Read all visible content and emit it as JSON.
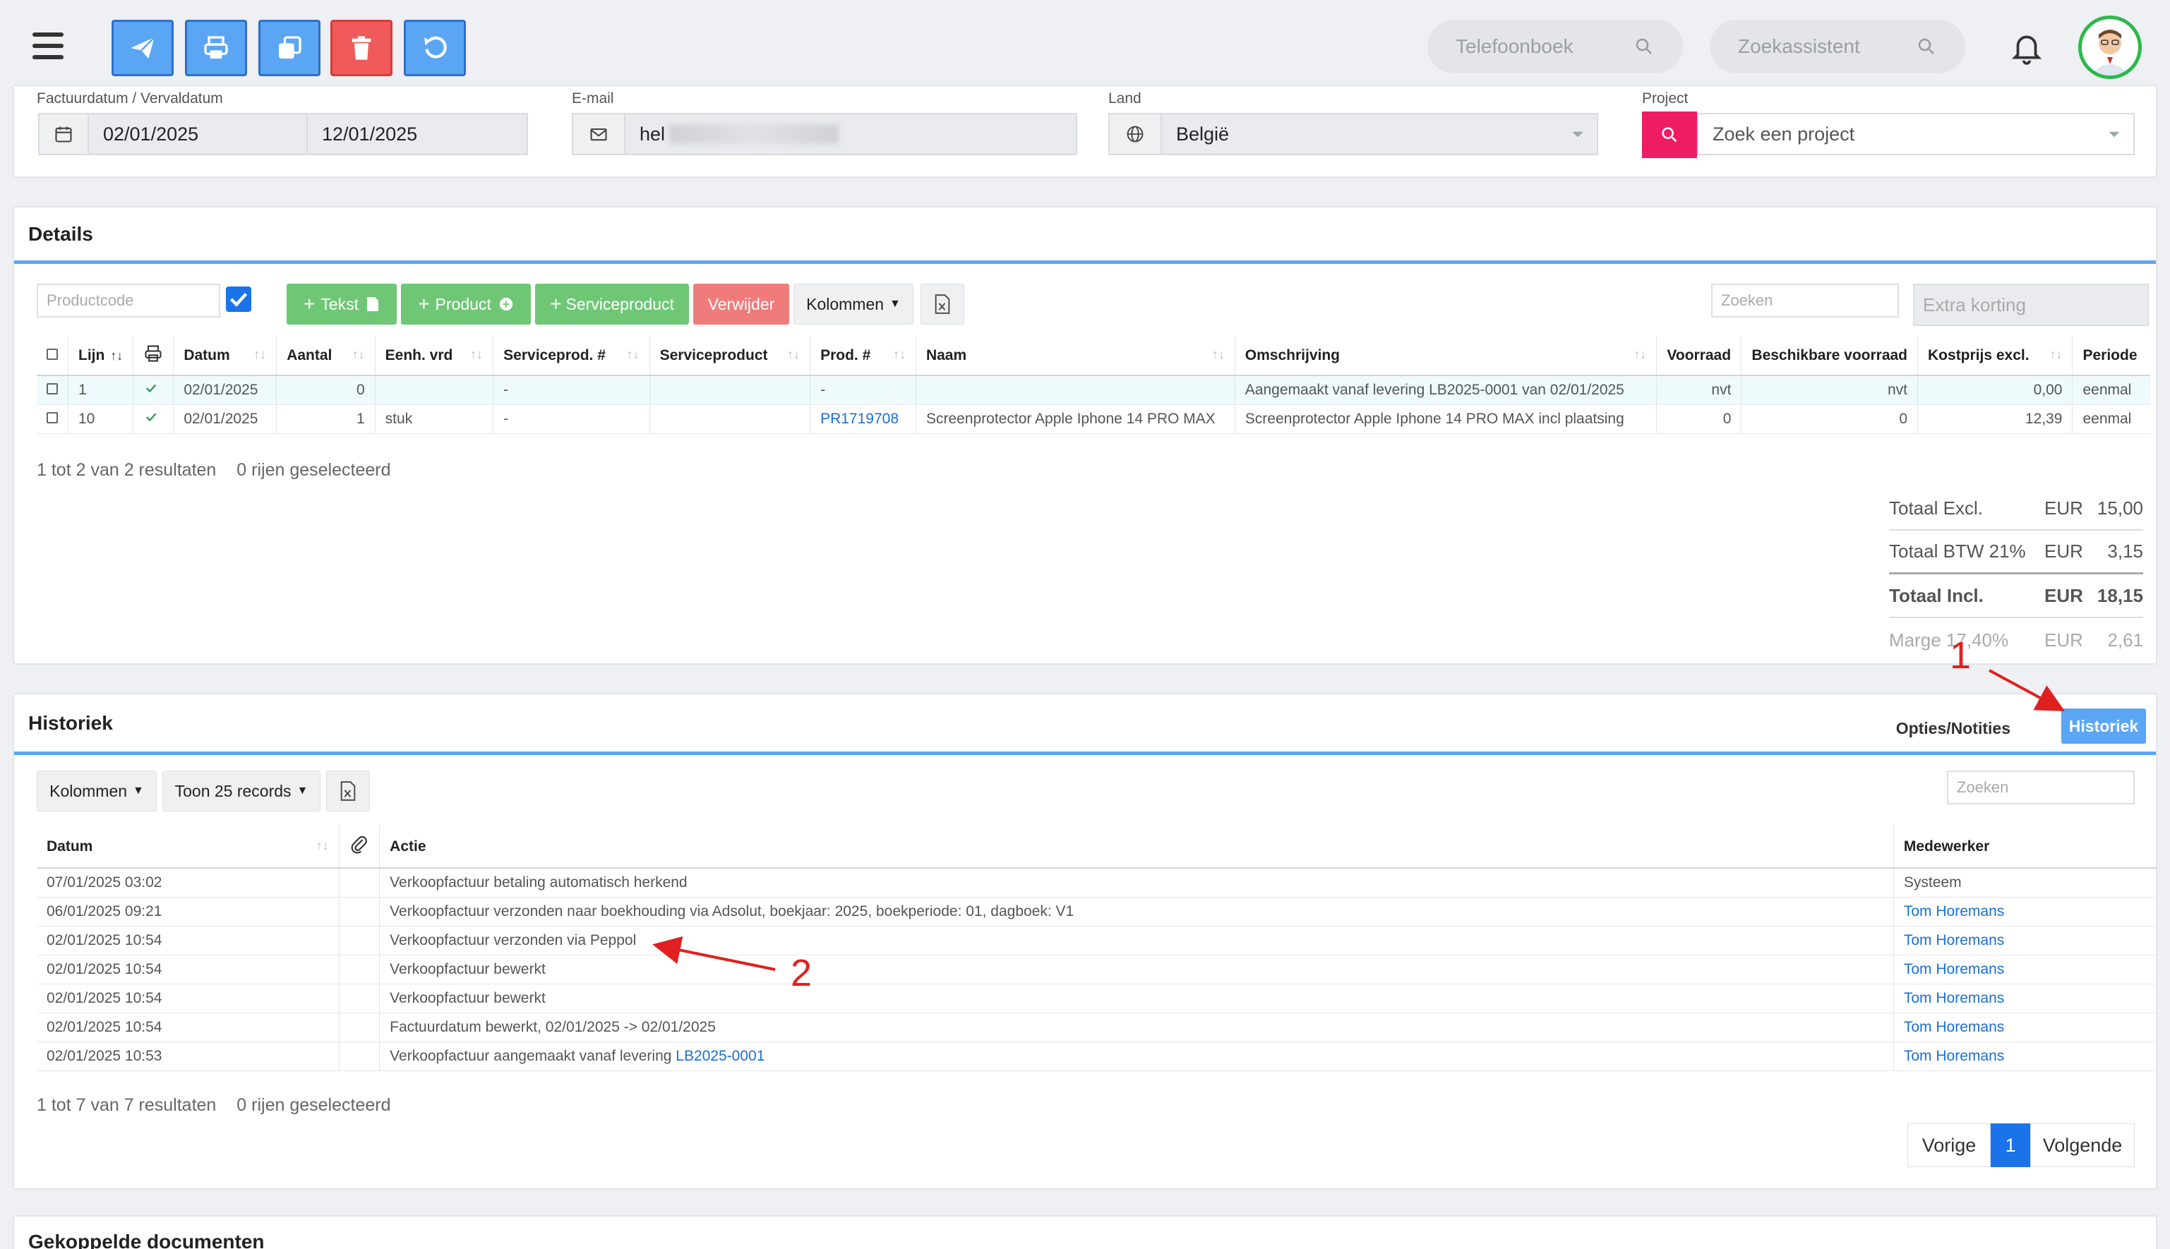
{
  "toolbar": {
    "phonebook_placeholder": "Telefoonboek",
    "assistant_placeholder": "Zoekassistent"
  },
  "header_fields": {
    "date_label": "Factuurdatum / Vervaldatum",
    "invoice_date": "02/01/2025",
    "due_date": "12/01/2025",
    "email_label": "E-mail",
    "email_value": "hel",
    "country_label": "Land",
    "country_value": "België",
    "project_label": "Project",
    "project_placeholder": "Zoek een project"
  },
  "details": {
    "title": "Details",
    "productcode_placeholder": "Productcode",
    "btn_text": "Tekst",
    "btn_product": "Product",
    "btn_serviceproduct": "Serviceproduct",
    "btn_delete": "Verwijder",
    "btn_columns": "Kolommen",
    "search_placeholder": "Zoeken",
    "extra_discount_placeholder": "Extra korting",
    "columns": [
      "Lijn",
      "Datum",
      "Aantal",
      "Eenh. vrd",
      "Serviceprod. #",
      "Serviceproduct",
      "Prod. #",
      "Naam",
      "Omschrijving",
      "Voorraad",
      "Beschikbare voorraad",
      "Kostprijs excl.",
      "Periode"
    ],
    "rows": [
      {
        "lijn": "1",
        "datum": "02/01/2025",
        "aantal": "0",
        "eenh": "",
        "sp_nr": "-",
        "sp": "",
        "prod_nr": "-",
        "naam": "",
        "omschrijving": "Aangemaakt vanaf levering LB2025-0001 van 02/01/2025",
        "voorraad": "nvt",
        "beschikbaar": "nvt",
        "kostprijs": "0,00",
        "periode": "eenmal"
      },
      {
        "lijn": "10",
        "datum": "02/01/2025",
        "aantal": "1",
        "eenh": "stuk",
        "sp_nr": "-",
        "sp": "",
        "prod_nr": "PR1719708",
        "naam": "Screenprotector Apple Iphone 14 PRO MAX",
        "omschrijving": "Screenprotector Apple Iphone 14 PRO MAX incl plaatsing",
        "voorraad": "0",
        "beschikbaar": "0",
        "kostprijs": "12,39",
        "periode": "eenmal"
      }
    ],
    "results_text": "1 tot 2 van 2 resultaten",
    "selected_text": "0 rijen geselecteerd",
    "totals": [
      {
        "label": "Totaal Excl.",
        "currency": "EUR",
        "value": "15,00"
      },
      {
        "label": "Totaal BTW 21%",
        "currency": "EUR",
        "value": "3,15"
      },
      {
        "label": "Totaal Incl.",
        "currency": "EUR",
        "value": "18,15"
      },
      {
        "label": "Marge 17,40%",
        "currency": "EUR",
        "value": "2,61"
      }
    ]
  },
  "history": {
    "title": "Historiek",
    "tab_notes": "Opties/Notities",
    "tab_history": "Historiek",
    "btn_columns": "Kolommen",
    "btn_show": "Toon 25 records",
    "search_placeholder": "Zoeken",
    "columns": [
      "Datum",
      "Actie",
      "Medewerker"
    ],
    "rows": [
      {
        "datum": "07/01/2025 03:02",
        "actie": "Verkoopfactuur betaling automatisch herkend",
        "actie_link": "",
        "medewerker": "Systeem"
      },
      {
        "datum": "06/01/2025 09:21",
        "actie": "Verkoopfactuur verzonden naar boekhouding via Adsolut, boekjaar: 2025, boekperiode: 01, dagboek: V1",
        "actie_link": "",
        "medewerker": "Tom Horemans"
      },
      {
        "datum": "02/01/2025 10:54",
        "actie": "Verkoopfactuur verzonden via Peppol",
        "actie_link": "",
        "medewerker": "Tom Horemans"
      },
      {
        "datum": "02/01/2025 10:54",
        "actie": "Verkoopfactuur bewerkt",
        "actie_link": "",
        "medewerker": "Tom Horemans"
      },
      {
        "datum": "02/01/2025 10:54",
        "actie": "Verkoopfactuur bewerkt",
        "actie_link": "",
        "medewerker": "Tom Horemans"
      },
      {
        "datum": "02/01/2025 10:54",
        "actie": "Factuurdatum bewerkt, 02/01/2025 -> 02/01/2025",
        "actie_link": "",
        "medewerker": "Tom Horemans"
      },
      {
        "datum": "02/01/2025 10:53",
        "actie": "Verkoopfactuur aangemaakt vanaf levering ",
        "actie_link": "LB2025-0001",
        "medewerker": "Tom Horemans"
      }
    ],
    "results_text": "1 tot 7 van 7 resultaten",
    "selected_text": "0 rijen geselecteerd",
    "pager": {
      "prev": "Vorige",
      "page": "1",
      "next": "Volgende"
    }
  },
  "linked": {
    "title": "Gekoppelde documenten"
  },
  "annotations": {
    "one": "1",
    "two": "2"
  }
}
